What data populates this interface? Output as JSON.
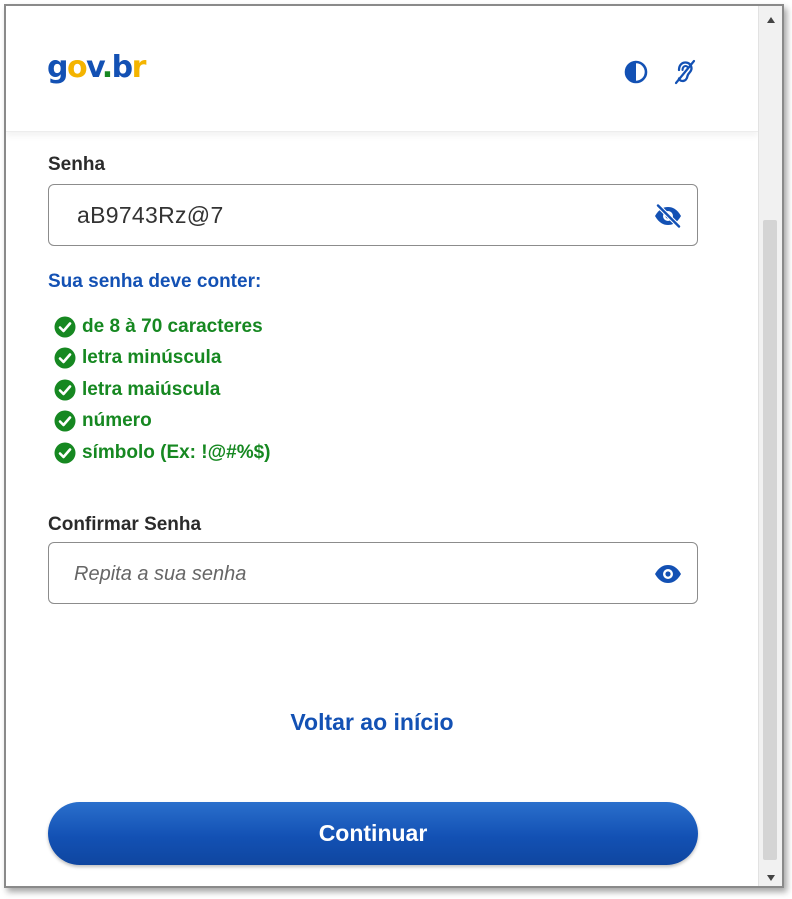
{
  "brand": {
    "logo_parts": [
      "g",
      "o",
      "v",
      ".",
      "b",
      "r"
    ],
    "colors": {
      "primary": "#1351b4",
      "yellow": "#f4b400",
      "success": "#168821"
    }
  },
  "header": {
    "contrast_icon": "contrast-icon",
    "accessibility_icon": "hearing-accessibility-icon"
  },
  "password": {
    "label": "Senha",
    "value": "aB9743Rz@7",
    "visibility_icon": "eye-slash-icon"
  },
  "requirements": {
    "title": "Sua senha deve conter:",
    "items": [
      {
        "text": "de 8 à 70 caracteres",
        "met": true
      },
      {
        "text": "letra minúscula",
        "met": true
      },
      {
        "text": "letra maiúscula",
        "met": true
      },
      {
        "text": "número",
        "met": true
      },
      {
        "text": "símbolo (Ex: !@#%$)",
        "met": true
      }
    ]
  },
  "confirm": {
    "label": "Confirmar Senha",
    "placeholder": "Repita a sua senha",
    "visibility_icon": "eye-icon"
  },
  "actions": {
    "back_link": "Voltar ao início",
    "continue_button": "Continuar"
  }
}
